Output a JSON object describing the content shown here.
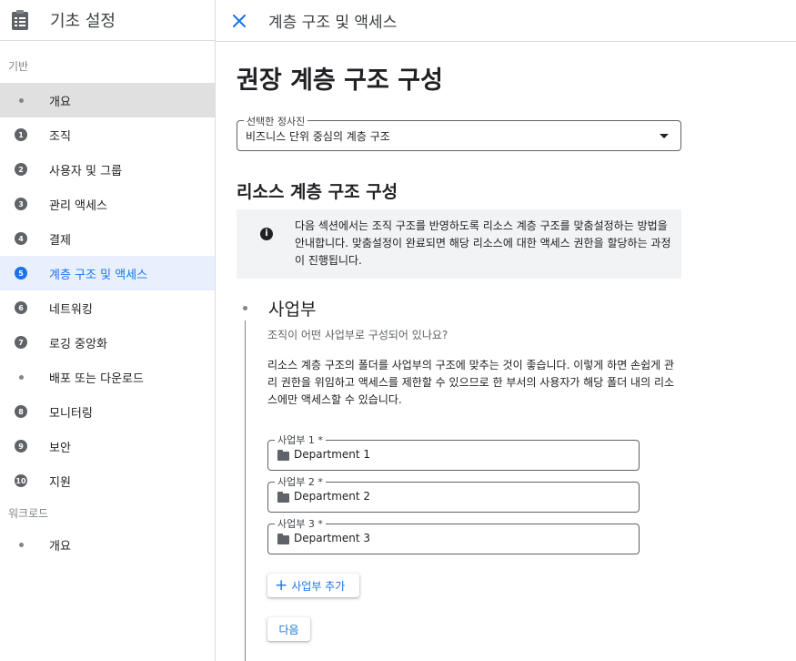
{
  "sidebar": {
    "title": "기초 설정",
    "section_basic": "기반",
    "items": [
      {
        "marker": "",
        "label": "개요"
      },
      {
        "marker": "1",
        "label": "조직"
      },
      {
        "marker": "2",
        "label": "사용자 및 그룹"
      },
      {
        "marker": "3",
        "label": "관리 액세스"
      },
      {
        "marker": "4",
        "label": "결제"
      },
      {
        "marker": "5",
        "label": "계층 구조 및 액세스"
      },
      {
        "marker": "6",
        "label": "네트워킹"
      },
      {
        "marker": "7",
        "label": "로깅 중앙화"
      },
      {
        "marker": "",
        "label": "배포 또는 다운로드"
      },
      {
        "marker": "8",
        "label": "모니터링"
      },
      {
        "marker": "9",
        "label": "보안"
      },
      {
        "marker": "10",
        "label": "지원"
      }
    ],
    "section_workload": "워크로드",
    "workload_items": [
      {
        "label": "개요"
      }
    ]
  },
  "topbar": {
    "title": "계층 구조 및 액세스"
  },
  "main": {
    "heading": "권장 계층 구조 구성",
    "select_label": "선택한 정사진",
    "select_value": "비즈니스 단위 중심의 계층 구조",
    "section_heading": "리소스 계층 구조 구성",
    "info_text": "다음 섹션에서는 조직 구조를 반영하도록 리소스 계층 구조를 맞춤설정하는 방법을 안내합니다. 맞춤설정이 완료되면 해당 리소스에 대한 액세스 권한을 할당하는 과정이 진행됩니다.",
    "step_title": "사업부",
    "step_question": "조직이 어떤 사업부로 구성되어 있나요?",
    "step_description": "리소스 계층 구조의 폴더를 사업부의 구조에 맞추는 것이 좋습니다. 이렇게 하면 손쉽게 관리 권한을 위임하고 액세스를 제한할 수 있으므로 한 부서의 사용자가 해당 폴더 내의 리소스에만 액세스할 수 있습니다.",
    "fields": [
      {
        "label": "사업부 1 *",
        "value": "Department 1"
      },
      {
        "label": "사업부 2 *",
        "value": "Department 2"
      },
      {
        "label": "사업부 3 *",
        "value": "Department 3"
      }
    ],
    "add_button": "사업부 추가",
    "next_button": "다음"
  },
  "colors": {
    "accent": "#1a73e8",
    "active_bg": "#e0e0e0",
    "current_bg": "#e8f0fe"
  }
}
